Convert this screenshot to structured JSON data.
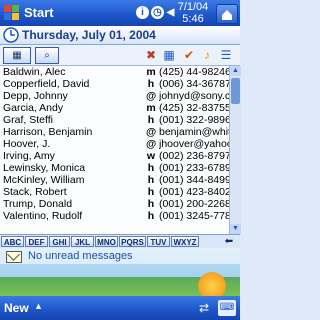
{
  "top_bar": {
    "start_label": "Start",
    "date_short": "7/1/04",
    "time": "5:46"
  },
  "date_bar": {
    "date": "Thursday, July 01, 2004"
  },
  "contacts": [
    {
      "name": "Baldwin, Alec",
      "type": "m",
      "value": "(425) 44-9824635"
    },
    {
      "name": "Copperfield, David",
      "type": "h",
      "value": "(006) 34-3678754"
    },
    {
      "name": "Depp, Johnny",
      "type": "@",
      "value": "johnyd@sony.com"
    },
    {
      "name": "Garcia, Andy",
      "type": "m",
      "value": "(425) 32-8375546"
    },
    {
      "name": "Graf, Steffi",
      "type": "h",
      "value": "(001) 322-9896678"
    },
    {
      "name": "Harrison, Benjamin",
      "type": "@",
      "value": "benjamin@whitehou"
    },
    {
      "name": "Hoover, J.",
      "type": "@",
      "value": "jhoover@yahoo.com"
    },
    {
      "name": "Irving, Amy",
      "type": "w",
      "value": "(002) 236-8797563"
    },
    {
      "name": "Lewinsky, Monica",
      "type": "h",
      "value": "(001) 233-6789774"
    },
    {
      "name": "McKinley, William",
      "type": "h",
      "value": "(001) 344-8499322"
    },
    {
      "name": "Stack, Robert",
      "type": "h",
      "value": "(001) 423-8402774"
    },
    {
      "name": "Trump, Donald",
      "type": "h",
      "value": "(001) 200-2268787"
    },
    {
      "name": "Valentino, Rudolf",
      "type": "h",
      "value": "(001) 3245-778977"
    }
  ],
  "alpha_tabs": [
    "ABC",
    "DEF",
    "GHI",
    "JKL",
    "MNO",
    "PQRS",
    "TUV",
    "WXYZ"
  ],
  "messages": {
    "status": "No unread messages"
  },
  "bottom_bar": {
    "new_label": "New"
  },
  "colors": {
    "bar_blue": "#1d55c9",
    "selection": "#1d55c9"
  }
}
